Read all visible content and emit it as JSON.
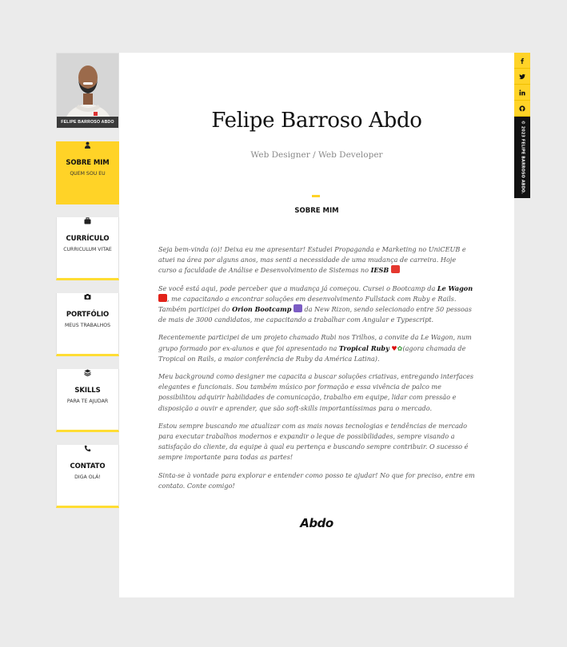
{
  "sidebar": {
    "profile_name": "FELIPE BARROSO ABDO",
    "items": [
      {
        "title": "SOBRE MIM",
        "subtitle": "QUEM SOU EU",
        "icon": "user-icon"
      },
      {
        "title": "CURRÍCULO",
        "subtitle": "CURRICULUM VITAE",
        "icon": "briefcase-icon"
      },
      {
        "title": "PORTFÓLIO",
        "subtitle": "MEUS TRABALHOS",
        "icon": "camera-icon"
      },
      {
        "title": "SKILLS",
        "subtitle": "PARA TE AJUDAR",
        "icon": "layers-icon"
      },
      {
        "title": "CONTATO",
        "subtitle": "DIGA OLÁ!",
        "icon": "phone-icon"
      }
    ]
  },
  "header": {
    "name": "Felipe Barroso Abdo",
    "role": "Web Designer / Web Developer"
  },
  "section": {
    "title": "SOBRE MIM",
    "p1_text": "Seja bem-vinda (o)! Deixa eu me apresentar! Estudei Propaganda e Marketing no UniCEUB e atuei na área por alguns anos, mas senti a necessidade de uma mudança de carreira. Hoje curso a faculdade de Análise e Desenvolvimento de Sistemas no ",
    "p1_bold": "IESB",
    "p2_a": "Se você está aqui, pode perceber que a mudança já começou. Cursei o Bootcamp da ",
    "p2_bold1": "Le Wagon",
    "p2_b": ", me capacitando a encontrar soluções em desenvolvimento Fullstack com Ruby e Rails. Também participei do ",
    "p2_bold2": "Orion Bootcamp",
    "p2_c": " da New Rizon, sendo selecionado entre 50 pessoas de mais de 3000 candidatos, me capacitando a trabalhar com Angular e Typescript.",
    "p3_a": "Recentemente participei de um projeto chamado Rubi nos Trilhos, a convite da Le Wagon, num grupo formado por ex-alunos e que foi apresentado na ",
    "p3_bold": "Tropical Ruby",
    "p3_b": "(agora chamada de Tropical on Rails, a maior conferência de Ruby da América Latina).",
    "p4": "Meu background como designer me capacita a buscar soluções criativas, entregando interfaces elegantes e funcionais. Sou também músico por formação e essa vivência de palco me possibilitou adquirir habilidades de comunicação, trabalho em equipe, lidar com pressão e disposição a ouvir e aprender, que são soft-skills importantíssimas para o mercado.",
    "p5": "Estou sempre buscando me atualizar com as mais novas tecnologias e tendências de mercado para executar trabalhos modernos e expandir o leque de possibilidades, sempre visando a satisfação do cliente, da equipe à qual eu pertença e buscando sempre contribuir. O sucesso é sempre importante para todas as partes!",
    "p6": "Sinta-se à vontade para explorar e entender como posso te ajudar! No que for preciso, entre em contato. Conte comigo!",
    "signature": "Abdo"
  },
  "social": {
    "facebook": "f",
    "twitter": "t",
    "linkedin": "in",
    "github": "gh",
    "copyright": "© 2023 FELIPE BARROSO ABDO."
  },
  "colors": {
    "accent": "#ffd327",
    "background": "#ebebeb",
    "card": "#ffffff"
  }
}
